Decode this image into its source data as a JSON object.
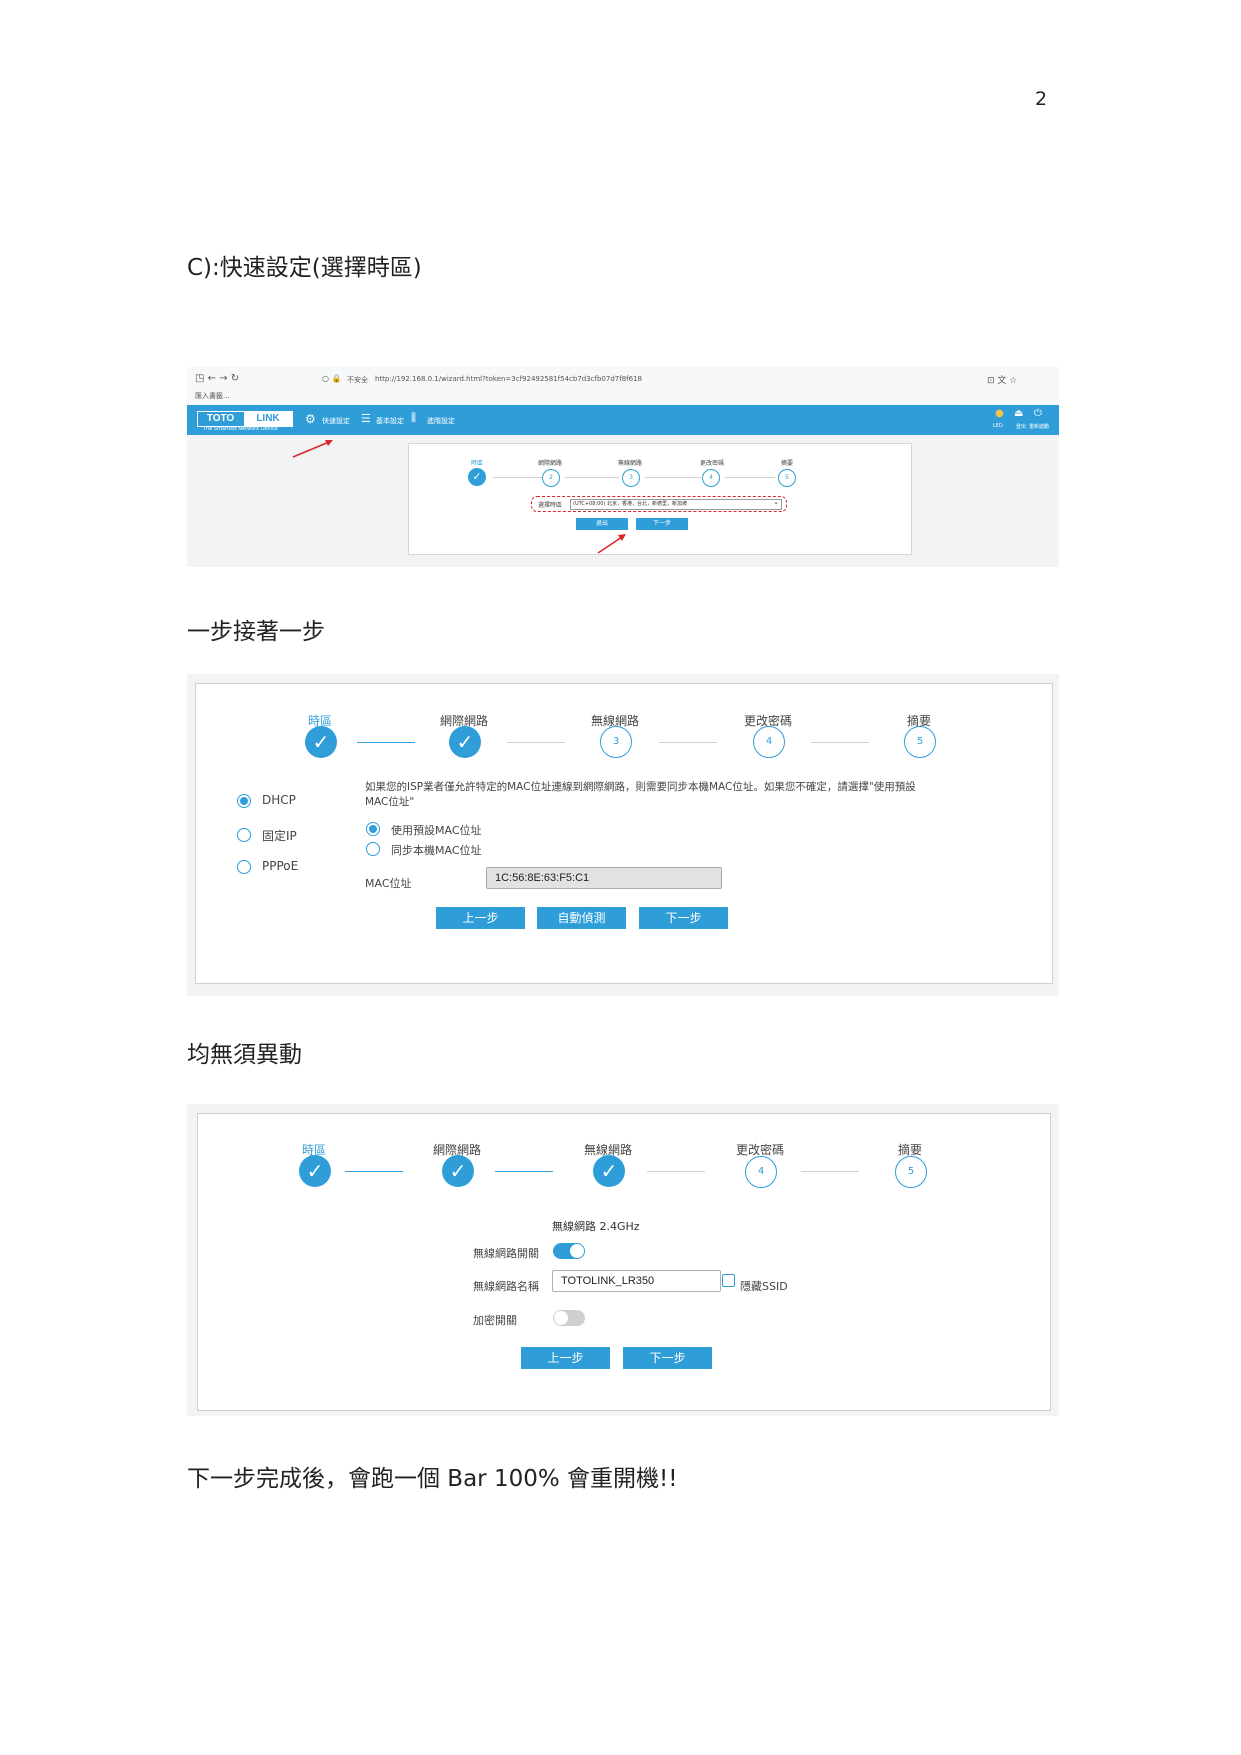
{
  "page": {
    "page_number": "2",
    "heading1": "C):快速設定(選擇時區)",
    "heading2": "一步接著一步",
    "heading3": "均無須異動",
    "heading4": "下一步完成後，會跑一個 Bar 100%  會重開機!!"
  },
  "shot1": {
    "security": "不安全",
    "url": "http://192.168.0.1/wizard.html?token=3cf92492581f54cb7d3cfb07d7f8f618",
    "bookmark": "匯入書籤...",
    "logo_left": "TOTO",
    "logo_right": "LINK",
    "logo_tagline": "The Smartest Network Device",
    "nav": [
      "快速設定",
      "基本設定",
      "進階設定"
    ],
    "right_icons": [
      "LED",
      "登出",
      "重新啟動"
    ],
    "steps": [
      "時區",
      "網際網路",
      "無線網路",
      "更改密碼",
      "摘要"
    ],
    "step_numbers": [
      "2",
      "3",
      "4",
      "5"
    ],
    "tz_label": "選擇時區",
    "tz_value": "(UTC+08:00) 北京，香港，台北，新德里，新加坡",
    "btn_exit": "退出",
    "btn_next": "下一步"
  },
  "shot2": {
    "steps": [
      "時區",
      "網際網路",
      "無線網路",
      "更改密碼",
      "摘要"
    ],
    "step_numbers": [
      "3",
      "4",
      "5"
    ],
    "modes": [
      "DHCP",
      "固定IP",
      "PPPoE"
    ],
    "info_line1": "如果您的ISP業者僅允許特定的MAC位址連線到網際網路，則需要同步本機MAC位址。如果您不確定，請選擇\"使用預設",
    "info_line2": "MAC位址\"",
    "mac_options": [
      "使用預設MAC位址",
      "同步本機MAC位址"
    ],
    "mac_label": "MAC位址",
    "mac_value": "1C:56:8E:63:F5:C1",
    "btn_prev": "上一步",
    "btn_detect": "自動偵測",
    "btn_next": "下一步"
  },
  "shot3": {
    "steps": [
      "時區",
      "網際網路",
      "無線網路",
      "更改密碼",
      "摘要"
    ],
    "step_numbers": [
      "4",
      "5"
    ],
    "section_title": "無線網路 2.4GHz",
    "wifi_switch_label": "無線網路開關",
    "ssid_label": "無線網路名稱",
    "ssid_value": "TOTOLINK_LR350",
    "hide_ssid_label": "隱藏SSID",
    "encrypt_label": "加密開關",
    "btn_prev": "上一步",
    "btn_next": "下一步"
  },
  "colors": {
    "accent": "#2f9ed8",
    "arrow": "#d9262b"
  }
}
